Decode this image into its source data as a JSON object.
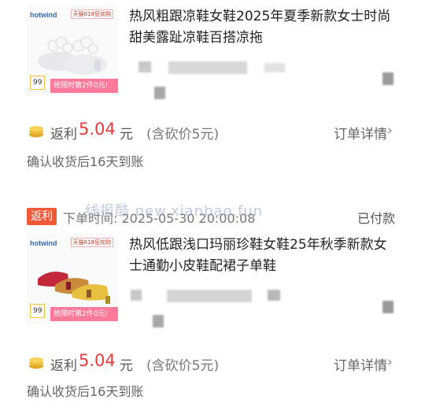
{
  "orders": [
    {
      "title": "热风粗跟凉鞋女鞋2025年夏季新款女士时尚甜美露趾凉鞋百搭凉拖",
      "thumb": {
        "brand": "hotwind",
        "top_tag": "天猫618狂欢购",
        "price": "99",
        "promo": "抢限时第2件0元!"
      },
      "rebate_label": "返利",
      "rebate_amount": "5.04",
      "rebate_unit": "元",
      "bargain": "(含砍价5元)",
      "detail_link": "订单详情",
      "confirm_text": "确认收货后16天到账"
    },
    {
      "title": "热风低跟浅口玛丽珍鞋女鞋25年秋季新款女士通勤小皮鞋配裙子单鞋",
      "thumb": {
        "brand": "hotwind",
        "top_tag": "天猫618狂欢购",
        "price": "99",
        "promo": "抢限时第2件0元!"
      },
      "rebate_label": "返利",
      "rebate_amount": "5.04",
      "rebate_unit": "元",
      "bargain": "(含砍价5元)",
      "detail_link": "订单详情",
      "confirm_text": "确认收货后16天到账",
      "badge": "返利",
      "order_time": "下单时间: 2025-05-30 20:00:08",
      "status": "已付款"
    }
  ],
  "watermark": "线报酷 new.xianbao.fun",
  "colors": {
    "accent": "#e8393a",
    "badge": "#f05a38"
  },
  "icons": {
    "coin": "coin-stack-icon",
    "chevron": "chevron-right-icon"
  }
}
